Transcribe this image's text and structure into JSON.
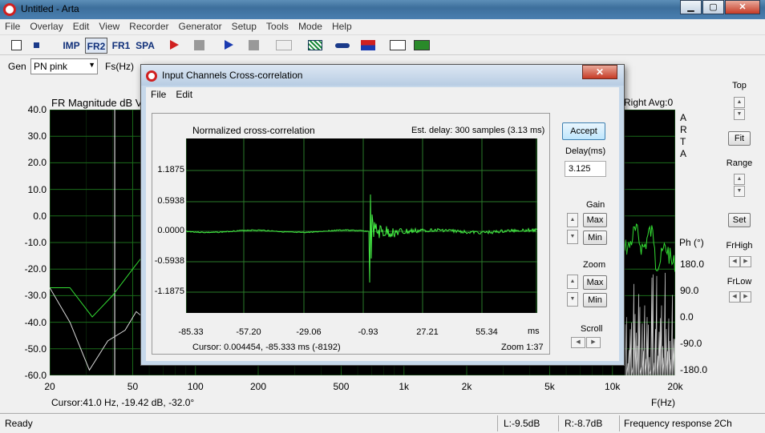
{
  "window": {
    "title": "Untitled - Arta",
    "controls": [
      "▁",
      "▢",
      "✕"
    ]
  },
  "menu": [
    "File",
    "Overlay",
    "Edit",
    "View",
    "Recorder",
    "Generator",
    "Setup",
    "Tools",
    "Mode",
    "Help"
  ],
  "toolbar": {
    "imp": "IMP",
    "fr2": "FR2",
    "fr1": "FR1",
    "spa": "SPA"
  },
  "gen": {
    "label": "Gen",
    "value": "PN pink",
    "fs_label": "Fs(Hz)"
  },
  "main_plot": {
    "title": "FR Magnitude dB V",
    "right_text": "Right  Avg:0",
    "brand": [
      "A",
      "R",
      "T",
      "A"
    ],
    "y_ticks": [
      "40.0",
      "30.0",
      "20.0",
      "10.0",
      "0.0",
      "-10.0",
      "-20.0",
      "-30.0",
      "-40.0",
      "-50.0",
      "-60.0"
    ],
    "x_ticks": [
      "20",
      "50",
      "100",
      "200",
      "500",
      "1k",
      "2k",
      "5k",
      "10k",
      "20k"
    ],
    "phase_label": "Ph (°)",
    "phase_ticks": [
      "180.0",
      "90.0",
      "0.0",
      "-90.0",
      "-180.0"
    ],
    "xlabel": "F(Hz)",
    "cursor": "Cursor:41.0 Hz, -19.42 dB, -32.0°",
    "colors": {
      "magnitude": "#33dd33",
      "phase": "#d9d9d9",
      "grid": "#1b6b1b"
    }
  },
  "right_panel": {
    "top": "Top",
    "fit": "Fit",
    "range": "Range",
    "set": "Set",
    "frhigh": "FrHigh",
    "frlow": "FrLow"
  },
  "status": {
    "ready": "Ready",
    "left": "L:-9.5dB",
    "right": "R:-8.7dB",
    "mode": "Frequency response 2Ch"
  },
  "dialog": {
    "title": "Input Channels Cross-correlation",
    "close": "✕",
    "menu": [
      "File",
      "Edit"
    ],
    "plot_title": "Normalized cross-correlation",
    "est_delay": "Est. delay: 300 samples (3.13 ms)",
    "y_ticks": [
      "1.1875",
      "0.5938",
      "0.0000",
      "-0.5938",
      "-1.1875"
    ],
    "x_ticks": [
      "-85.33",
      "-57.20",
      "-29.06",
      "-0.93",
      "27.21",
      "55.34"
    ],
    "x_unit": "ms",
    "cursor": "Cursor: 0.004454,  -85.333 ms  (-8192)",
    "zoom": "Zoom 1:37",
    "accept": "Accept",
    "delay_label": "Delay(ms)",
    "delay_value": "3.125",
    "gain": "Gain",
    "zoom_label": "Zoom",
    "max": "Max",
    "min": "Min",
    "scroll": "Scroll"
  }
}
